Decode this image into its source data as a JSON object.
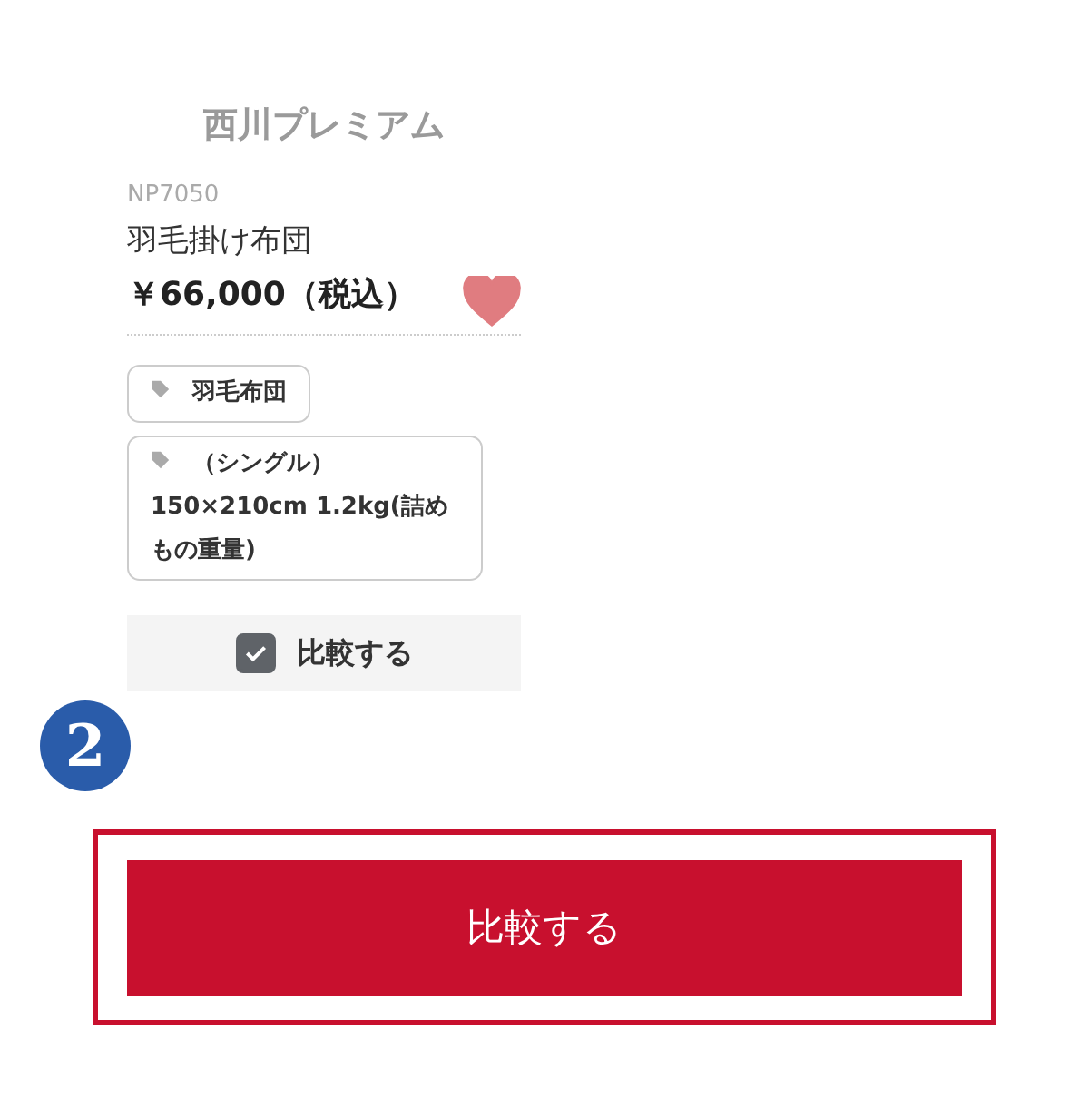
{
  "product": {
    "brand": "西川プレミアム",
    "code": "NP7050",
    "name": "羽毛掛け布団",
    "price": "￥66,000（税込）",
    "favorite": true
  },
  "tags": [
    {
      "lines": [
        "羽毛布団"
      ]
    },
    {
      "lines": [
        "（シングル）",
        "150×210cm 1.2kg(詰めもの重量)"
      ]
    }
  ],
  "compare": {
    "label": "比較する",
    "checked": true
  },
  "step_badge": "2",
  "compare_button": {
    "label": "比較する",
    "highlighted": true
  }
}
